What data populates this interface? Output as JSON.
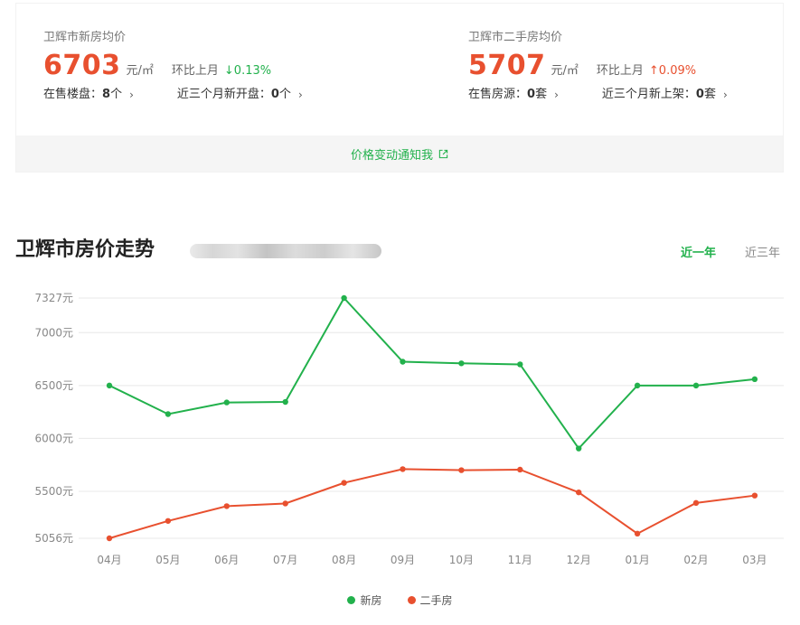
{
  "summary": {
    "new": {
      "city_label": "卫辉市新房均价",
      "price": "6703",
      "unit": "元/㎡",
      "mom_label": "环比上月",
      "mom_value": "↓0.13%",
      "stat1_label": "在售楼盘：",
      "stat1_value": "8",
      "stat1_suffix": " 个",
      "stat2_label": "近三个月新开盘：",
      "stat2_value": "0",
      "stat2_suffix": " 个"
    },
    "second": {
      "city_label": "卫辉市二手房均价",
      "price": "5707",
      "unit": "元/㎡",
      "mom_label": "环比上月",
      "mom_value": "↑0.09%",
      "stat1_label": "在售房源：",
      "stat1_value": "0",
      "stat1_suffix": " 套",
      "stat2_label": "近三个月新上架：",
      "stat2_value": "0",
      "stat2_suffix": " 套"
    },
    "chevron": "›",
    "notify_label": "价格变动通知我"
  },
  "trend": {
    "title": "卫辉市房价走势",
    "tab_active": "近一年",
    "tab_inactive": "近三年"
  },
  "colors": {
    "new_series": "#22b14c",
    "second_series": "#e8502f",
    "grid": "#e8e8e8"
  },
  "chart_data": {
    "type": "line",
    "x": [
      "04月",
      "05月",
      "06月",
      "07月",
      "08月",
      "09月",
      "10月",
      "11月",
      "12月",
      "01月",
      "02月",
      "03月"
    ],
    "series": [
      {
        "name": "新房",
        "values": [
          6500,
          6230,
          6340,
          6345,
          7327,
          6725,
          6710,
          6700,
          5905,
          6500,
          6500,
          6560
        ]
      },
      {
        "name": "二手房",
        "values": [
          5056,
          5220,
          5360,
          5385,
          5580,
          5710,
          5700,
          5705,
          5490,
          5100,
          5390,
          5460
        ]
      }
    ],
    "y_ticks": [
      {
        "value": 5056,
        "label": "5056元"
      },
      {
        "value": 5500,
        "label": "5500元"
      },
      {
        "value": 6000,
        "label": "6000元"
      },
      {
        "value": 6500,
        "label": "6500元"
      },
      {
        "value": 7000,
        "label": "7000元"
      },
      {
        "value": 7327,
        "label": "7327元"
      }
    ],
    "ylim": [
      5056,
      7327
    ],
    "grid": true,
    "legend_position": "bottom-center"
  }
}
